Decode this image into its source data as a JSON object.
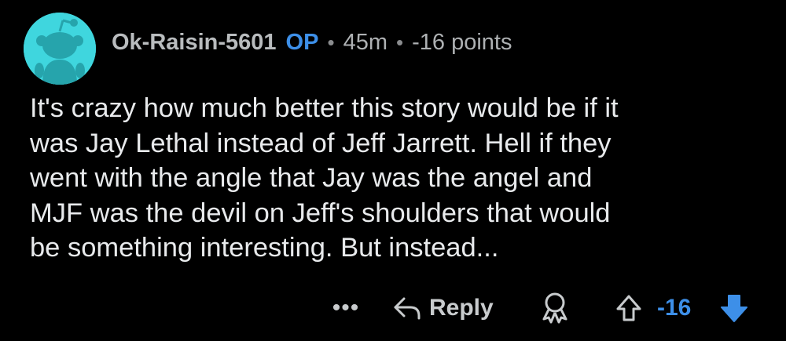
{
  "comment": {
    "username": "Ok-Raisin-5601",
    "op_badge": "OP",
    "separator": "•",
    "time": "45m",
    "points": "-16 points",
    "body_lines": [
      "It's crazy how much better this story would be if it",
      "was Jay Lethal instead of Jeff Jarrett. Hell if they",
      "went with the angle that Jay was the angel and",
      "MJF was the devil on Jeff's shoulders that would",
      "be something interesting. But instead..."
    ]
  },
  "actions": {
    "more": "•••",
    "reply_label": "Reply",
    "score": "-16"
  },
  "icons": {
    "avatar": "snoo-avatar-icon",
    "more": "more-options-icon",
    "reply": "reply-arrow-icon",
    "award": "award-icon",
    "upvote": "upvote-arrow-icon",
    "downvote": "downvote-arrow-icon"
  },
  "colors": {
    "background": "#000000",
    "avatar_bg": "#3fd6de",
    "accent_blue": "#3d8fe8",
    "username": "#b9bcbe",
    "body_text": "#e8eaec"
  }
}
